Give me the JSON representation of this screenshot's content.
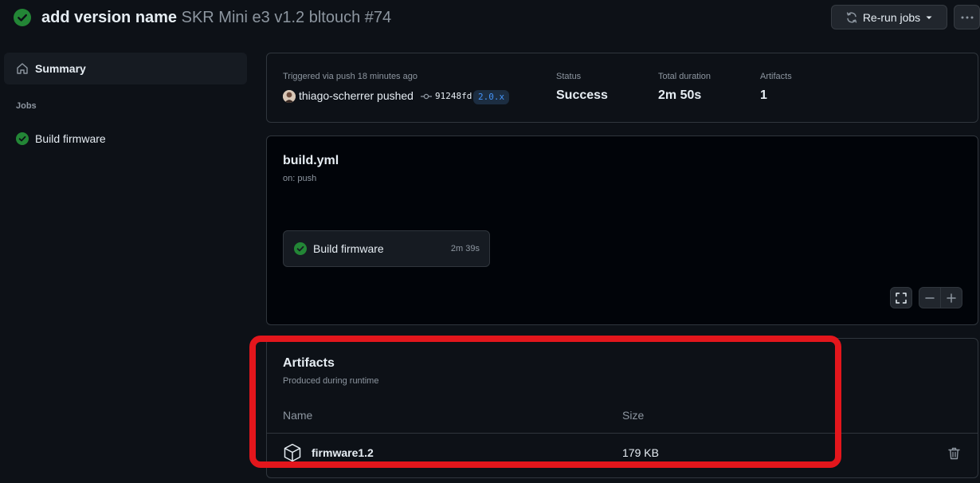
{
  "header": {
    "commit_title": "add version name",
    "run_name": "SKR Mini e3 v1.2 bltouch #74",
    "rerun_label": "Re-run jobs"
  },
  "sidebar": {
    "summary_label": "Summary",
    "jobs_heading": "Jobs",
    "jobs": [
      {
        "label": "Build firmware",
        "status": "success"
      }
    ]
  },
  "summary": {
    "trigger_text": "Triggered via push 18 minutes ago",
    "pusher": "thiago-scherrer pushed",
    "commit_sha": "91248fd",
    "branch": "2.0.x",
    "status_label": "Status",
    "status_value": "Success",
    "duration_label": "Total duration",
    "duration_value": "2m 50s",
    "artifacts_label": "Artifacts",
    "artifacts_value": "1"
  },
  "workflow": {
    "file": "build.yml",
    "trigger": "on: push",
    "job_label": "Build firmware",
    "job_duration": "2m 39s"
  },
  "artifacts": {
    "title": "Artifacts",
    "subtitle": "Produced during runtime",
    "col_name": "Name",
    "col_size": "Size",
    "items": [
      {
        "name": "firmware1.2",
        "size": "179 KB"
      }
    ]
  },
  "colors": {
    "background": "#0d1117",
    "success": "#238636",
    "accent": "#4493f8",
    "highlight": "#e3161c"
  }
}
